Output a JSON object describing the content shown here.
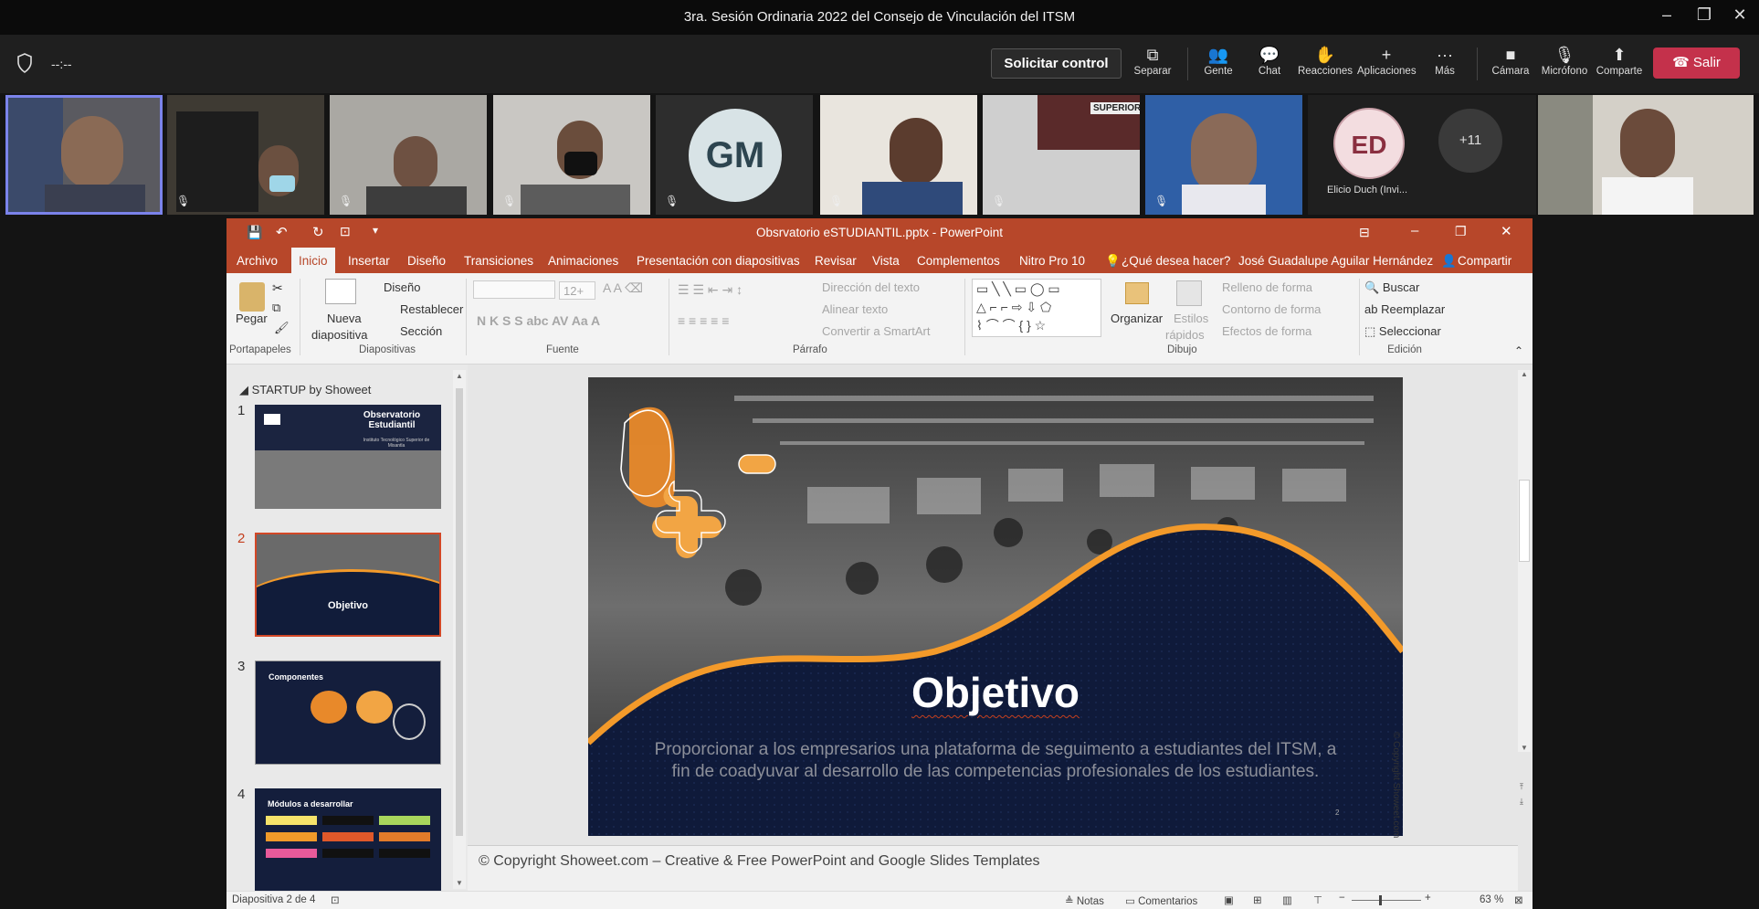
{
  "window": {
    "title": "3ra. Sesión Ordinaria 2022 del Consejo de Vinculación del ITSM"
  },
  "teams": {
    "timer": "--:--",
    "request_control": "Solicitar control",
    "buttons": {
      "separar": "Separar",
      "gente": "Gente",
      "chat": "Chat",
      "reacciones": "Reacciones",
      "aplicaciones": "Aplicaciones",
      "mas": "Más",
      "camara": "Cámara",
      "microfono": "Micrófono",
      "comparte": "Comparte"
    },
    "leave": "Salir"
  },
  "participants": {
    "gm_initials": "GM",
    "ed_initials": "ED",
    "ed_name": "Elicio Duch (Invi...",
    "overflow": "+11",
    "sign_text": "SUPERIOR"
  },
  "ppt": {
    "title": "Obsrvatorio eSTUDIANTIL.pptx - PowerPoint",
    "tabs": [
      "Archivo",
      "Inicio",
      "Insertar",
      "Diseño",
      "Transiciones",
      "Animaciones",
      "Presentación con diapositivas",
      "Revisar",
      "Vista",
      "Complementos",
      "Nitro Pro 10"
    ],
    "tell_me": "¿Qué desea hacer?",
    "user": "José Guadalupe Aguilar Hernández",
    "share": "Compartir",
    "ribbon": {
      "pegar": "Pegar",
      "nueva": "Nueva",
      "diapositiva": "diapositiva",
      "diseno": "Diseño",
      "restablecer": "Restablecer",
      "seccion": "Sección",
      "font_size": "12+",
      "direccion": "Dirección del texto",
      "alinear": "Alinear texto",
      "convertir": "Convertir a SmartArt",
      "organizar": "Organizar",
      "estilos": "Estilos",
      "rapidos": "rápidos",
      "relleno": "Relleno de forma",
      "contorno": "Contorno de forma",
      "efectos": "Efectos de forma",
      "buscar": "Buscar",
      "reemplazar": "Reemplazar",
      "seleccionar": "Seleccionar",
      "groups": {
        "portapapeles": "Portapapeles",
        "diapositivas": "Diapositivas",
        "fuente": "Fuente",
        "parrafo": "Párrafo",
        "dibujo": "Dibujo",
        "edicion": "Edición"
      }
    },
    "section": "STARTUP by Showeet",
    "thumbs": [
      {
        "num": "1",
        "title": "Observatorio Estudiantil",
        "sub": "Instituto Tecnológico Superior de Misantla"
      },
      {
        "num": "2",
        "title": "Objetivo"
      },
      {
        "num": "3",
        "title": "Componentes"
      },
      {
        "num": "4",
        "title": "Módulos a desarrollar"
      }
    ],
    "slide": {
      "title": "Objetivo",
      "body": "Proporcionar a los empresarios una plataforma de seguimento a estudiantes del ITSM, a fin de coadyuvar al desarrollo de las competencias profesionales de los estudiantes.",
      "copyright_side": "© Copyright Showeet.com",
      "page": "2"
    },
    "notes_text": "© Copyright Showeet.com – Creative & Free PowerPoint and Google Slides Templates",
    "status": {
      "slide": "Diapositiva 2 de 4",
      "notas": "Notas",
      "comentarios": "Comentarios",
      "zoom": "63 %"
    }
  }
}
